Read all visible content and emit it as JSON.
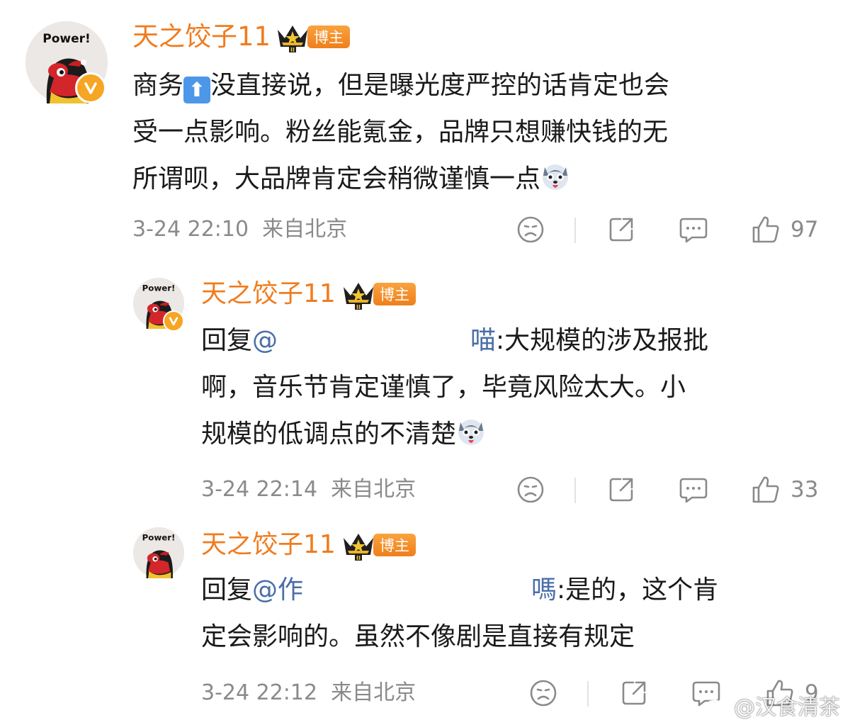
{
  "comments": [
    {
      "username": "天之饺子11",
      "badge_label": "博主",
      "avatar_caption": "Power!",
      "body_lines": [
        "商务⬆没直接说，但是曝光度严控的话肯定也会",
        "受一点影响。粉丝能氪金，品牌只想赚快钱的无",
        "所谓呗，大品牌肯定会稍微谨慎一点"
      ],
      "body_line1_before_emoji": "商务",
      "body_line1_after_emoji": "没直接说，但是曝光度严控的话肯定也会",
      "body_line2": "受一点影响。粉丝能氪金，品牌只想赚快钱的无",
      "body_line3": "所谓呗，大品牌肯定会稍微谨慎一点",
      "timestamp": "3-24 22:10",
      "location": "来自北京",
      "likes": "97"
    },
    {
      "username": "天之饺子11",
      "badge_label": "博主",
      "avatar_caption": "Power!",
      "reply_prefix": "回复",
      "mention_start": "@",
      "mention_end": "喵",
      "reply_line1_after": ":大规模的涉及报批",
      "body_line2": "啊，音乐节肯定谨慎了，毕竟风险太大。小",
      "body_line3": "规模的低调点的不清楚",
      "timestamp": "3-24 22:14",
      "location": "来自北京",
      "likes": "33"
    },
    {
      "username": "天之饺子11",
      "badge_label": "博主",
      "avatar_caption": "Power!",
      "reply_prefix": "回复",
      "mention_start": "@作",
      "mention_end": "嗎",
      "reply_line1_after": ":是的，这个肯",
      "body_line2": "定会影响的。虽然不像剧是直接有规定",
      "timestamp": "3-24 22:12",
      "location": "来自北京",
      "likes": "9"
    }
  ],
  "watermark": "@汉食清茶",
  "icons": {
    "emoji_up": "up-arrow-emoji-icon",
    "emoji_dog": "husky-dog-emoji-icon",
    "dislike": "sad-face-icon",
    "share": "share-icon",
    "comment": "comment-bubble-icon",
    "like": "thumbs-up-icon",
    "verified": "verified-v-icon",
    "crown": "crown-icon",
    "weibo": "weibo-logo-icon"
  },
  "colors": {
    "username": "#f07c1e",
    "mention": "#4a6ea8",
    "meta": "#8a8a8a",
    "badge": "#ef7f1b"
  }
}
